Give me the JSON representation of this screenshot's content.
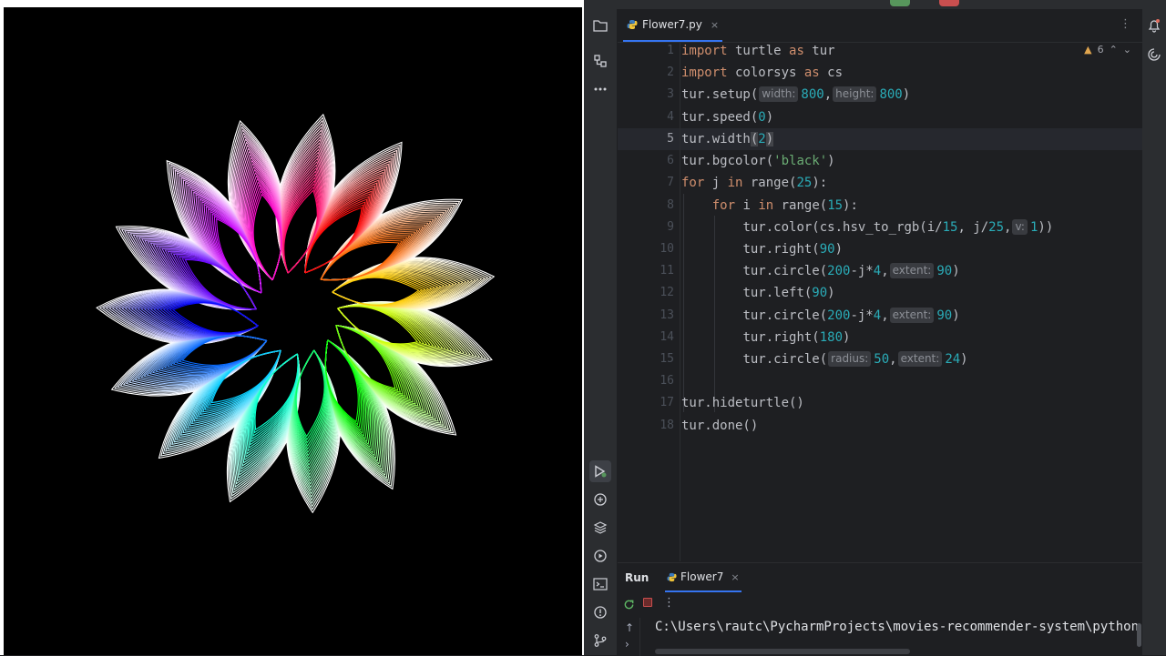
{
  "turtle_window": {
    "background": "#000000"
  },
  "ide": {
    "editor_tab": {
      "filename": "Flower7.py",
      "close": "×",
      "more": "⋮"
    },
    "inspection": {
      "warnings": "6",
      "up": "⌃",
      "down": "⌄"
    },
    "line_numbers": [
      "1",
      "2",
      "3",
      "4",
      "5",
      "6",
      "7",
      "8",
      "9",
      "10",
      "11",
      "12",
      "13",
      "14",
      "15",
      "16",
      "17",
      "18"
    ],
    "current_line": "5",
    "code": {
      "l1": {
        "kw1": "import",
        "mod": " turtle ",
        "kw2": "as",
        "alias": " tur"
      },
      "l2": {
        "kw1": "import",
        "mod": " colorsys ",
        "kw2": "as",
        "alias": " cs"
      },
      "l3": {
        "pre": "tur.setup(",
        "hint1": "width:",
        "v1": "800",
        "sep": ",",
        "hint2": "height:",
        "v2": "800",
        "post": ")"
      },
      "l4": {
        "pre": "tur.speed(",
        "v": "0",
        "post": ")"
      },
      "l5": {
        "pre": "tur.width",
        "open": "(",
        "v": "2",
        "close": ")"
      },
      "l6": {
        "pre": "tur.bgcolor(",
        "s": "'black'",
        "post": ")"
      },
      "l7": {
        "kw1": "for",
        "a": " j ",
        "kw2": "in",
        "b": " range(",
        "v": "25",
        "post": "):"
      },
      "l8": {
        "indent": "    ",
        "kw1": "for",
        "a": " i ",
        "kw2": "in",
        "b": " range(",
        "v": "15",
        "post": "):"
      },
      "l9": {
        "indent": "        ",
        "pre": "tur.color(cs.hsv_to_rgb(i/",
        "v1": "15",
        "mid": ", j/",
        "v2": "25",
        "sep": ",",
        "hint": "v:",
        "v3": "1",
        "post": "))"
      },
      "l10": {
        "indent": "        ",
        "pre": "tur.right(",
        "v": "90",
        "post": ")"
      },
      "l11": {
        "indent": "        ",
        "pre": "tur.circle(",
        "v1": "200",
        "mid": "-j*",
        "v2": "4",
        "sep": ",",
        "hint": "extent:",
        "v3": "90",
        "post": ")"
      },
      "l12": {
        "indent": "        ",
        "pre": "tur.left(",
        "v": "90",
        "post": ")"
      },
      "l13": {
        "indent": "        ",
        "pre": "tur.circle(",
        "v1": "200",
        "mid": "-j*",
        "v2": "4",
        "sep": ",",
        "hint": "extent:",
        "v3": "90",
        "post": ")"
      },
      "l14": {
        "indent": "        ",
        "pre": "tur.right(",
        "v": "180",
        "post": ")"
      },
      "l15": {
        "indent": "        ",
        "pre": "tur.circle(",
        "hint1": "radius:",
        "v1": "50",
        "sep": ",",
        "hint2": "extent:",
        "v2": "24",
        "post": ")"
      },
      "l16": "",
      "l17": "tur.hideturtle()",
      "l18": "tur.done()"
    },
    "run_panel": {
      "title": "Run",
      "tab_label": "Flower7",
      "tab_close": "×",
      "console_line": "C:\\Users\\rautc\\PycharmProjects\\movies-recommender-system\\python"
    }
  },
  "icons": {
    "left_toolbar": [
      "folder-icon",
      "structure-icon",
      "more-icon",
      "run-icon",
      "python-console-icon",
      "layers-icon",
      "services-icon",
      "terminal-icon",
      "problems-icon",
      "git-icon"
    ],
    "right_toolbar": [
      "notifications-icon",
      "ai-assistant-icon"
    ]
  }
}
